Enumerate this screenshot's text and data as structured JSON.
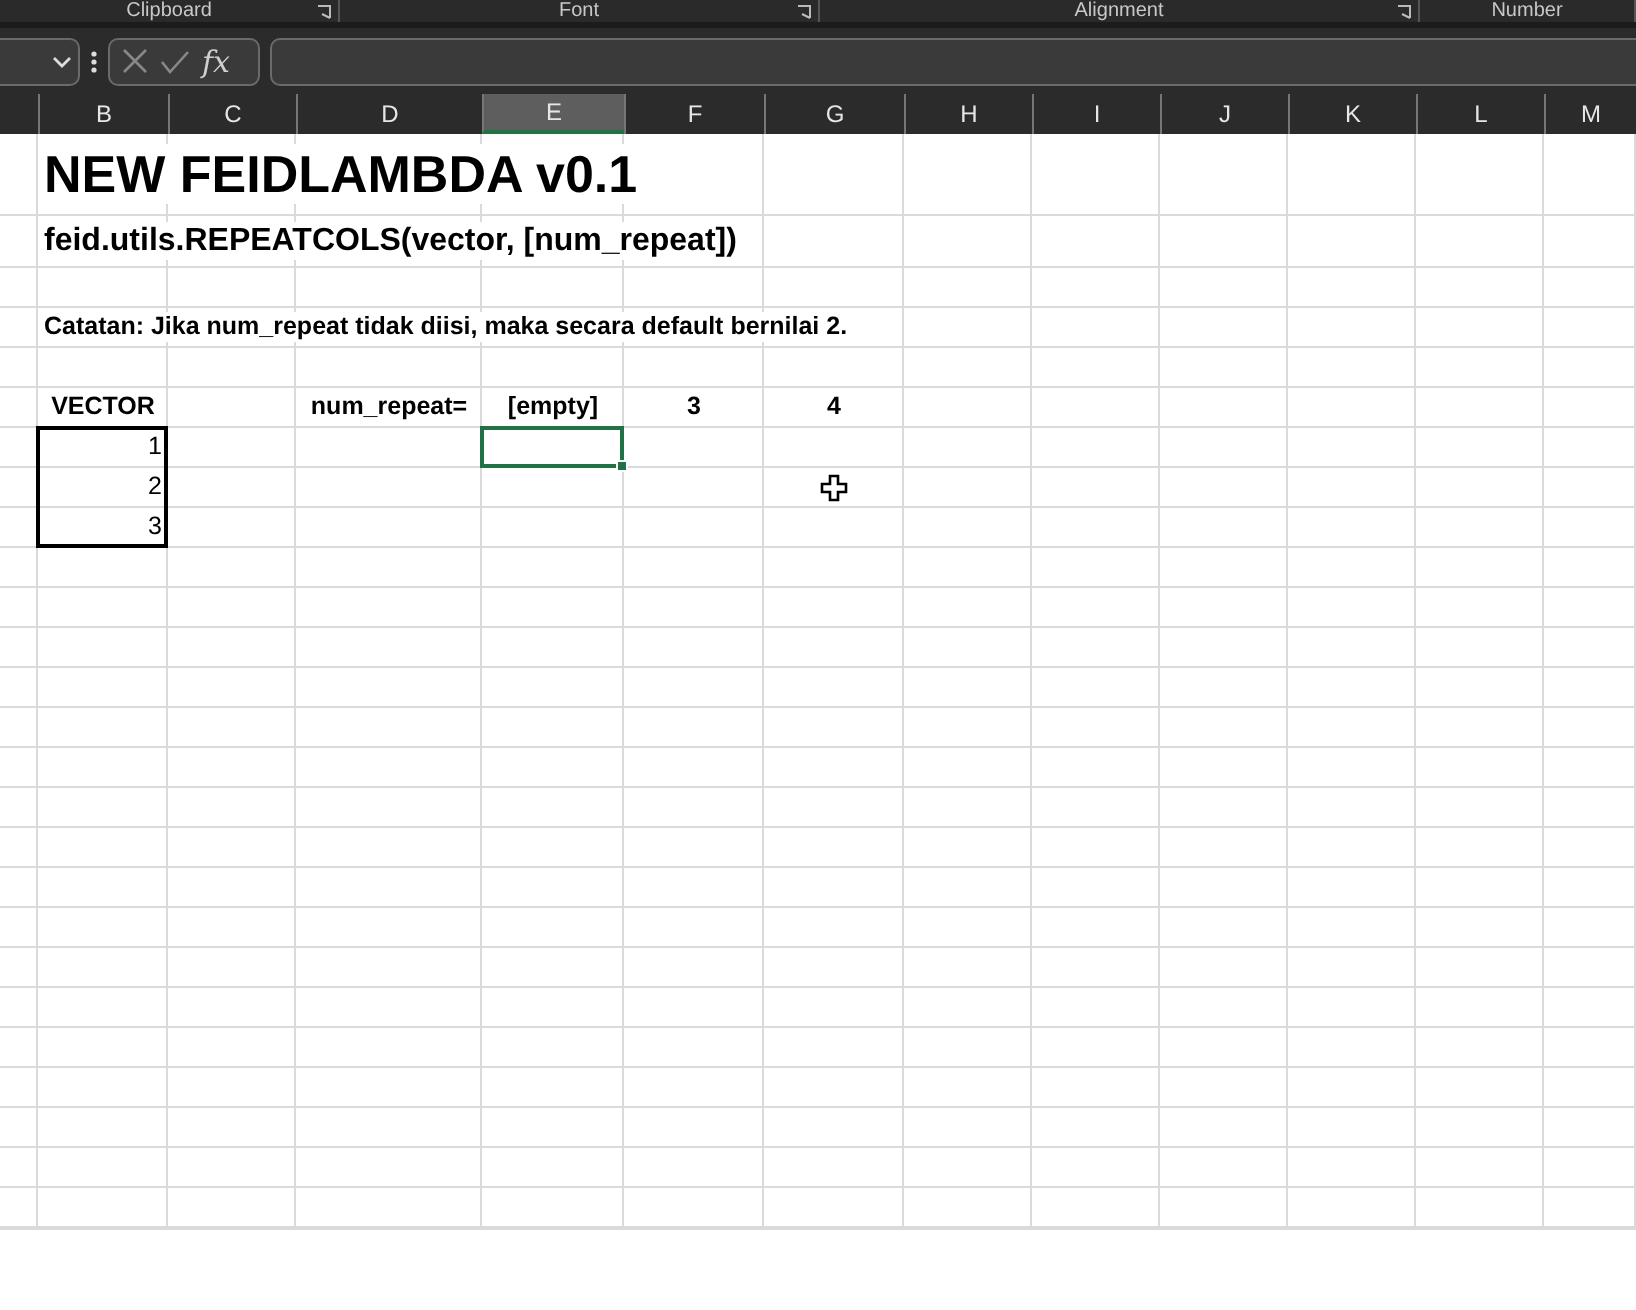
{
  "ribbon_groups": [
    "Clipboard",
    "Font",
    "Alignment",
    "Number"
  ],
  "formula_bar": {
    "function_label": "fx"
  },
  "columns": [
    {
      "label": "B",
      "selected": false
    },
    {
      "label": "C",
      "selected": false
    },
    {
      "label": "D",
      "selected": false
    },
    {
      "label": "E",
      "selected": true
    },
    {
      "label": "F",
      "selected": false
    },
    {
      "label": "G",
      "selected": false
    },
    {
      "label": "H",
      "selected": false
    },
    {
      "label": "I",
      "selected": false
    },
    {
      "label": "J",
      "selected": false
    },
    {
      "label": "K",
      "selected": false
    },
    {
      "label": "L",
      "selected": false
    },
    {
      "label": "M",
      "selected": false
    }
  ],
  "rows": [
    {
      "kind": "title",
      "cells": {
        "B": {
          "text": "NEW FEIDLAMBDA v0.1"
        }
      }
    },
    {
      "kind": "subtitle",
      "cells": {
        "B": {
          "text": "feid.utils.REPEATCOLS(vector, [num_repeat])"
        }
      }
    },
    {
      "kind": "blank"
    },
    {
      "kind": "note",
      "cells": {
        "B": {
          "text": "Catatan: Jika num_repeat tidak diisi, maka secara default bernilai 2."
        }
      }
    },
    {
      "kind": "blank"
    },
    {
      "kind": "header",
      "cells": {
        "B": {
          "text": "VECTOR"
        },
        "D": {
          "text": "num_repeat="
        },
        "E": {
          "text": "[empty]"
        },
        "F": {
          "text": "3"
        },
        "G": {
          "text": "4"
        }
      }
    },
    {
      "kind": "data",
      "cells": {
        "B": {
          "text": "1",
          "boxed": true
        },
        "E": {
          "selected": true
        }
      }
    },
    {
      "kind": "data",
      "cells": {
        "B": {
          "text": "2",
          "boxed": true
        },
        "G": {
          "pointer": true
        }
      }
    },
    {
      "kind": "data",
      "cells": {
        "B": {
          "text": "3",
          "boxed": true
        }
      }
    }
  ]
}
